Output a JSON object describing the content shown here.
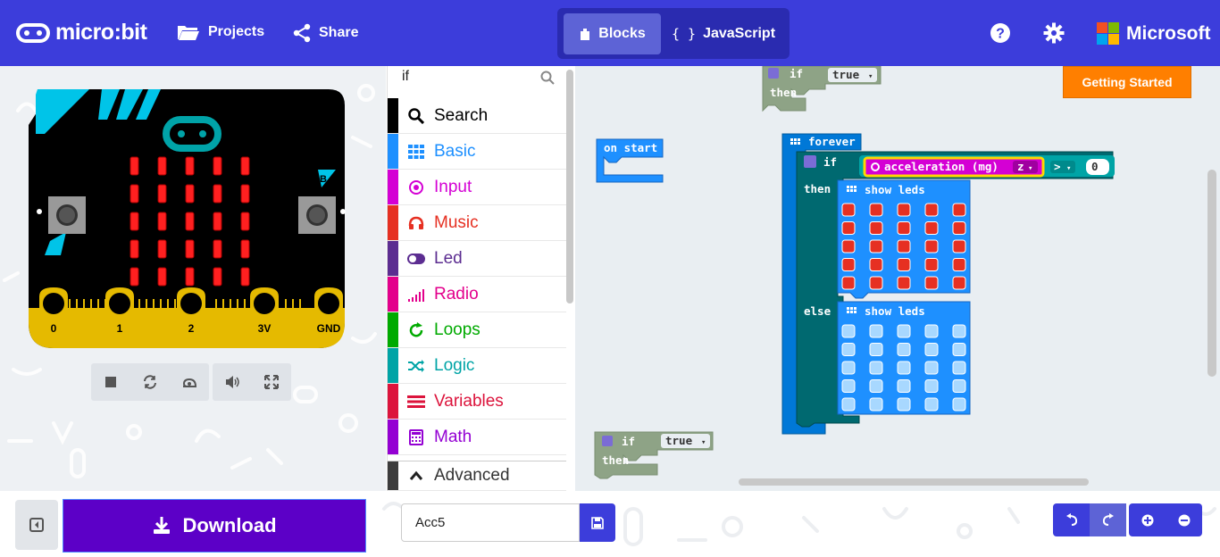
{
  "header": {
    "brand": "micro:bit",
    "projects_label": "Projects",
    "share_label": "Share",
    "tabs": [
      {
        "label": "Blocks"
      },
      {
        "label": "JavaScript"
      }
    ],
    "active_tab": "Blocks",
    "microsoft_label": "Microsoft"
  },
  "simulator": {
    "button_a": "A",
    "button_b": "B",
    "pins": [
      "0",
      "1",
      "2",
      "3V",
      "GND"
    ],
    "led_matrix": [
      [
        1,
        1,
        1,
        1,
        1
      ],
      [
        1,
        1,
        1,
        1,
        1
      ],
      [
        1,
        1,
        1,
        1,
        1
      ],
      [
        1,
        1,
        1,
        1,
        1
      ],
      [
        1,
        1,
        1,
        1,
        1
      ]
    ],
    "controls": [
      "stop-icon",
      "restart-icon",
      "slowmo-icon",
      "sound-icon",
      "fullscreen-icon"
    ]
  },
  "toolbox": {
    "search_value": "if",
    "categories": [
      {
        "label": "Search",
        "color": "#000000",
        "icon": "search-icon"
      },
      {
        "label": "Basic",
        "color": "#1e90ff",
        "icon": "grid-icon"
      },
      {
        "label": "Input",
        "color": "#d400d4",
        "icon": "target-icon"
      },
      {
        "label": "Music",
        "color": "#e63022",
        "icon": "headphones-icon"
      },
      {
        "label": "Led",
        "color": "#5c2d91",
        "icon": "toggle-icon"
      },
      {
        "label": "Radio",
        "color": "#e3008c",
        "icon": "signal-icon"
      },
      {
        "label": "Loops",
        "color": "#00aa00",
        "icon": "refresh-icon"
      },
      {
        "label": "Logic",
        "color": "#00a4a6",
        "icon": "shuffle-icon"
      },
      {
        "label": "Variables",
        "color": "#dc143c",
        "icon": "list-icon"
      },
      {
        "label": "Math",
        "color": "#9400d3",
        "icon": "calculator-icon"
      }
    ],
    "advanced_label": "Advanced"
  },
  "workspace": {
    "getting_started_label": "Getting Started",
    "if_block_top": {
      "if": "if",
      "value": "true",
      "then": "then"
    },
    "on_start": "on start",
    "forever": "forever",
    "if_block": {
      "if": "if",
      "then": "then",
      "else": "else"
    },
    "condition": {
      "sensor": "acceleration (mg)",
      "axis": "z",
      "op": ">",
      "value": "0"
    },
    "show_leds_label": "show leds",
    "then_leds": [
      [
        1,
        1,
        1,
        1,
        1
      ],
      [
        1,
        1,
        1,
        1,
        1
      ],
      [
        1,
        1,
        1,
        1,
        1
      ],
      [
        1,
        1,
        1,
        1,
        1
      ],
      [
        1,
        1,
        1,
        1,
        1
      ]
    ],
    "else_leds": [
      [
        0,
        0,
        0,
        0,
        0
      ],
      [
        0,
        0,
        0,
        0,
        0
      ],
      [
        0,
        0,
        0,
        0,
        0
      ],
      [
        0,
        0,
        0,
        0,
        0
      ],
      [
        0,
        0,
        0,
        0,
        0
      ]
    ],
    "if_block_bottom": {
      "if": "if",
      "value": "true",
      "then": "then"
    }
  },
  "footer": {
    "download_label": "Download",
    "project_name": "Acc5"
  },
  "colors": {
    "header": "#3c3ddb",
    "download": "#5c00c7",
    "logic_block": "#006970",
    "loops_block": "#0078d7",
    "basic_block": "#1e90ff",
    "input_block": "#d400d4",
    "led_on": "#e63022",
    "led_off": "#a8d8ff",
    "getting_started": "#ff7f00"
  }
}
